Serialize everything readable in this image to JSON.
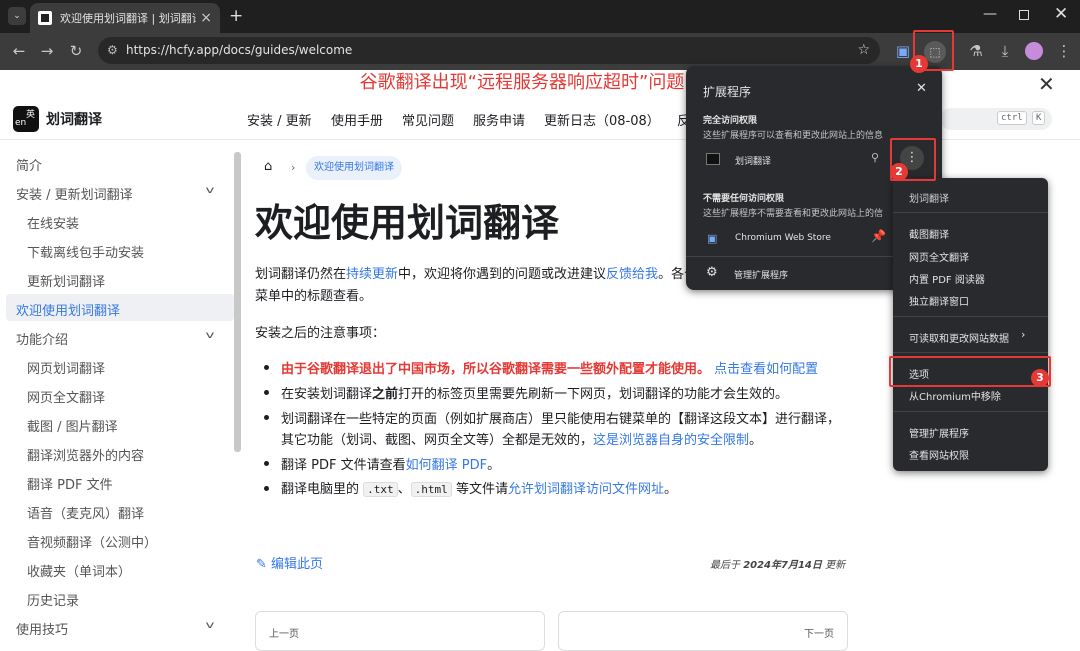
{
  "browser": {
    "tab_title": "欢迎使用划词翻译 | 划词翻译",
    "url": "https://hcfy.app/docs/guides/welcome"
  },
  "page": {
    "banner": "谷歌翻译出现“远程服务器响应超时”问题的解",
    "logo_glyph_top": "英",
    "logo_glyph_bottom": "en",
    "site_name": "划词翻译",
    "nav": [
      "安装 / 更新",
      "使用手册",
      "常见问题",
      "服务申请",
      "更新日志（08-08）",
      "反"
    ],
    "search_keys": [
      "ctrl",
      "K"
    ],
    "sidebar": [
      {
        "label": "简介",
        "level": 0
      },
      {
        "label": "安装 / 更新划词翻译",
        "level": 0,
        "expanded": true
      },
      {
        "label": "在线安装",
        "level": 1
      },
      {
        "label": "下载离线包手动安装",
        "level": 1
      },
      {
        "label": "更新划词翻译",
        "level": 1
      },
      {
        "label": "欢迎使用划词翻译",
        "level": 0,
        "active": true
      },
      {
        "label": "功能介绍",
        "level": 0,
        "expanded": true
      },
      {
        "label": "网页划词翻译",
        "level": 1
      },
      {
        "label": "网页全文翻译",
        "level": 1
      },
      {
        "label": "截图 / 图片翻译",
        "level": 1
      },
      {
        "label": "翻译浏览器外的内容",
        "level": 1
      },
      {
        "label": "翻译 PDF 文件",
        "level": 1
      },
      {
        "label": "语音（麦克风）翻译",
        "level": 1
      },
      {
        "label": "音视频翻译（公测中）",
        "level": 1
      },
      {
        "label": "收藏夹（单词本）",
        "level": 1
      },
      {
        "label": "历史记录",
        "level": 1
      },
      {
        "label": "使用技巧",
        "level": 0,
        "expanded": true
      }
    ],
    "breadcrumb_current": "欢迎使用划词翻译",
    "title": "欢迎使用划词翻译",
    "intro_1a": "划词翻译仍然在",
    "intro_1_link1": "持续更新",
    "intro_1b": "中，欢迎将你遇到的问题或改进建议",
    "intro_1_link2": "反馈给我",
    "intro_1c": "。各个",
    "intro_2": "菜单中的标题查看。",
    "notes_heading": "安装之后的注意事项：",
    "b1_red": "由于谷歌翻译退出了中国市场，所以谷歌翻译需要一些额外配置才能使用。",
    "b1_link": "点击查看如何配置",
    "b2a": "在安装划词翻译",
    "b2_bold": "之前",
    "b2b": "打开的标签页里需要先刷新一下网页，划词翻译的功能才会生效的。",
    "b3a": "划词翻译在一些特定的页面（例如扩展商店）里只能使用右键菜单的【翻译这段文本】进行翻译，",
    "b3b": "其它功能（划词、截图、网页全文等）全都是无效的，",
    "b3_link": "这是浏览器自身的安全限制",
    "b3c": "。",
    "b4a": "翻译 PDF 文件请查看",
    "b4_link": "如何翻译 PDF",
    "b4b": "。",
    "b5a": "翻译电脑里的",
    "b5_code1": ".txt",
    "b5_sep": "、",
    "b5_code2": ".html",
    "b5b": "等文件请",
    "b5_link": "允许划词翻译访问文件网址",
    "b5c": "。",
    "edit_link": "编辑此页",
    "last_updated_prefix": "最后于",
    "last_updated_date": "2024年7月14日",
    "last_updated_suffix": "更新",
    "prev": "上一页",
    "next": "下一页"
  },
  "extensions_popup": {
    "title": "扩展程序",
    "full_access_heading": "完全访问权限",
    "full_access_desc": "这些扩展程序可以查看和更改此网站上的信息",
    "ext1_name": "划词翻译",
    "no_access_heading": "不需要任何访问权限",
    "no_access_desc": "这些扩展程序不需要查看和更改此网站上的信",
    "ext2_name": "Chromium Web Store",
    "manage": "管理扩展程序"
  },
  "context_menu": {
    "items": [
      "划词翻译",
      "截图翻译",
      "网页全文翻译",
      "内置 PDF 阅读器",
      "独立翻译窗口",
      "可读取和更改网站数据",
      "选项",
      "从Chromium中移除",
      "管理扩展程序",
      "查看网站权限"
    ]
  },
  "steps": [
    "1",
    "2",
    "3"
  ],
  "colors": {
    "accent": "#3578e5",
    "annotation": "#e53935",
    "browser_dark": "#3c3c3c"
  }
}
